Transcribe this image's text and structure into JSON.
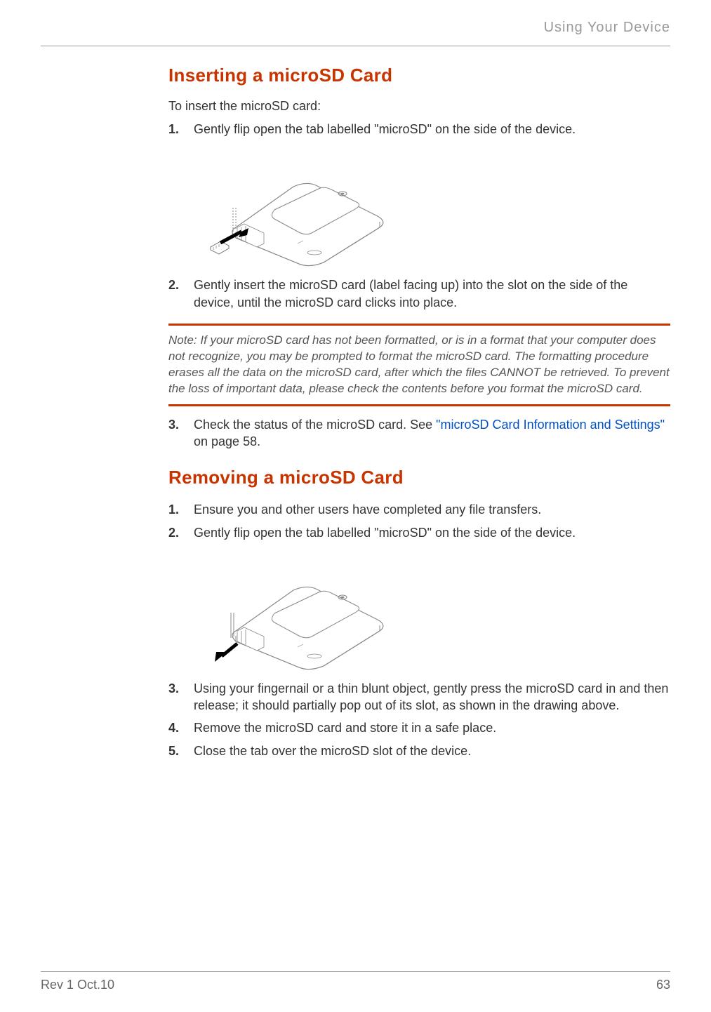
{
  "header": {
    "section_title": "Using Your Device"
  },
  "section1": {
    "heading": "Inserting a microSD Card",
    "lead": "To insert the microSD card:",
    "steps": [
      "Gently flip open the tab labelled \"microSD\" on the side of the device.",
      "Gently insert the microSD card (label facing up) into the slot on the side of the device, until the microSD card clicks into place.",
      "Check the status of the microSD card. See "
    ],
    "step3_link": "\"microSD Card Information and Settings\"",
    "step3_tail": " on page 58.",
    "note_label": "Note: ",
    "note_body": "If your microSD card has not been formatted, or is in a format that your computer does not recognize, you may be prompted to format the microSD card. The formatting procedure erases all the data on the microSD card, after which the files CANNOT be retrieved. To prevent the loss of important data, please check the contents before you format the microSD card."
  },
  "section2": {
    "heading": "Removing a microSD Card",
    "steps": [
      "Ensure you and other users have completed any file transfers.",
      "Gently flip open the tab labelled \"microSD\" on the side of the device.",
      "Using your fingernail or a thin blunt object, gently press the microSD card in and then release; it should partially pop out of its slot, as shown in the drawing above.",
      "Remove the microSD card and store it in a safe place.",
      "Close the tab over the microSD slot of the device."
    ]
  },
  "footer": {
    "rev": "Rev 1  Oct.10",
    "page_number": "63"
  }
}
